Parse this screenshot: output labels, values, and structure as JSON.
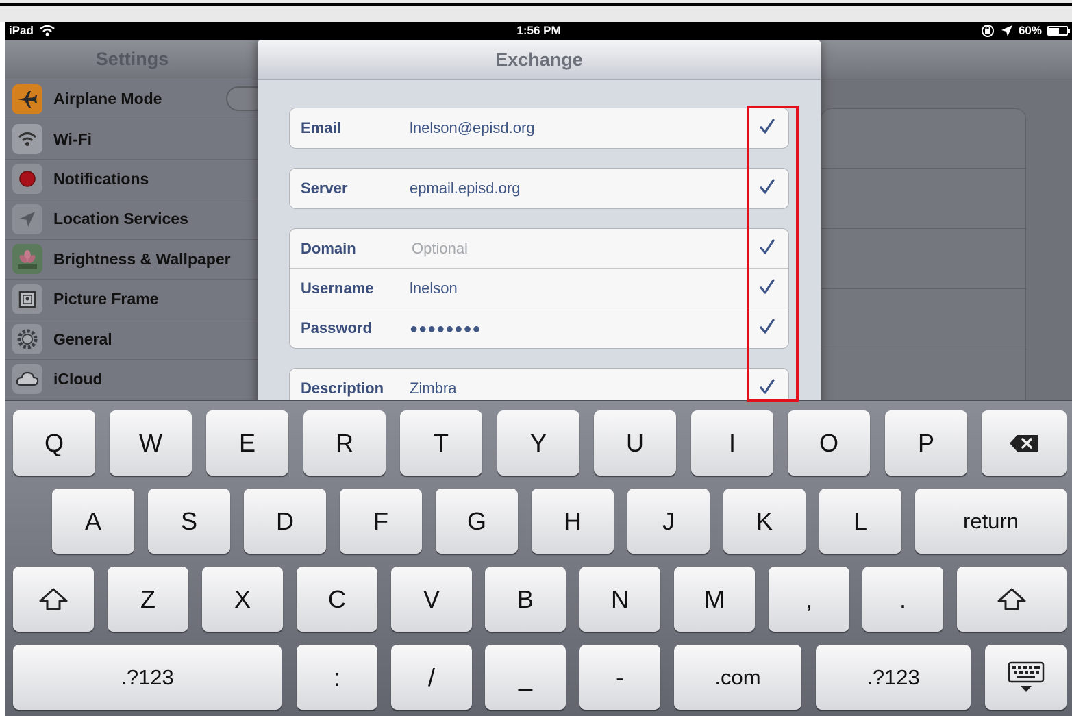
{
  "status_bar": {
    "device": "iPad",
    "time": "1:56 PM",
    "battery": "60%",
    "battery_level": 0.6
  },
  "settings": {
    "title": "Settings",
    "items": [
      {
        "label": "Airplane Mode",
        "icon": "airplane-icon"
      },
      {
        "label": "Wi-Fi",
        "icon": "wifi-icon"
      },
      {
        "label": "Notifications",
        "icon": "notifications-icon"
      },
      {
        "label": "Location Services",
        "icon": "location-icon"
      },
      {
        "label": "Brightness & Wallpaper",
        "icon": "flower-icon"
      },
      {
        "label": "Picture Frame",
        "icon": "picture-frame-icon"
      },
      {
        "label": "General",
        "icon": "gear-icon"
      },
      {
        "label": "iCloud",
        "icon": "cloud-icon"
      }
    ]
  },
  "exchange": {
    "title": "Exchange",
    "fields": {
      "email": {
        "label": "Email",
        "value": "lnelson@episd.org"
      },
      "server": {
        "label": "Server",
        "value": "epmail.episd.org"
      },
      "domain": {
        "label": "Domain",
        "placeholder": "Optional"
      },
      "username": {
        "label": "Username",
        "value": "lnelson"
      },
      "password": {
        "label": "Password",
        "value": "●●●●●●●●"
      },
      "description": {
        "label": "Description",
        "value": "Zimbra"
      }
    }
  },
  "keyboard": {
    "row1": [
      "Q",
      "W",
      "E",
      "R",
      "T",
      "Y",
      "U",
      "I",
      "O",
      "P"
    ],
    "row2": [
      "A",
      "S",
      "D",
      "F",
      "G",
      "H",
      "J",
      "K",
      "L"
    ],
    "row3": [
      "Z",
      "X",
      "C",
      "V",
      "B",
      "N",
      "M",
      ",",
      "."
    ],
    "return": "return",
    "numbers": ".?123",
    "colon": ":",
    "slash": "/",
    "underscore": "_",
    "dash": "-",
    "dotcom": ".com"
  },
  "colors": {
    "highlight": "#e3101b",
    "label": "#3c4f7b",
    "value": "#3f5583"
  }
}
